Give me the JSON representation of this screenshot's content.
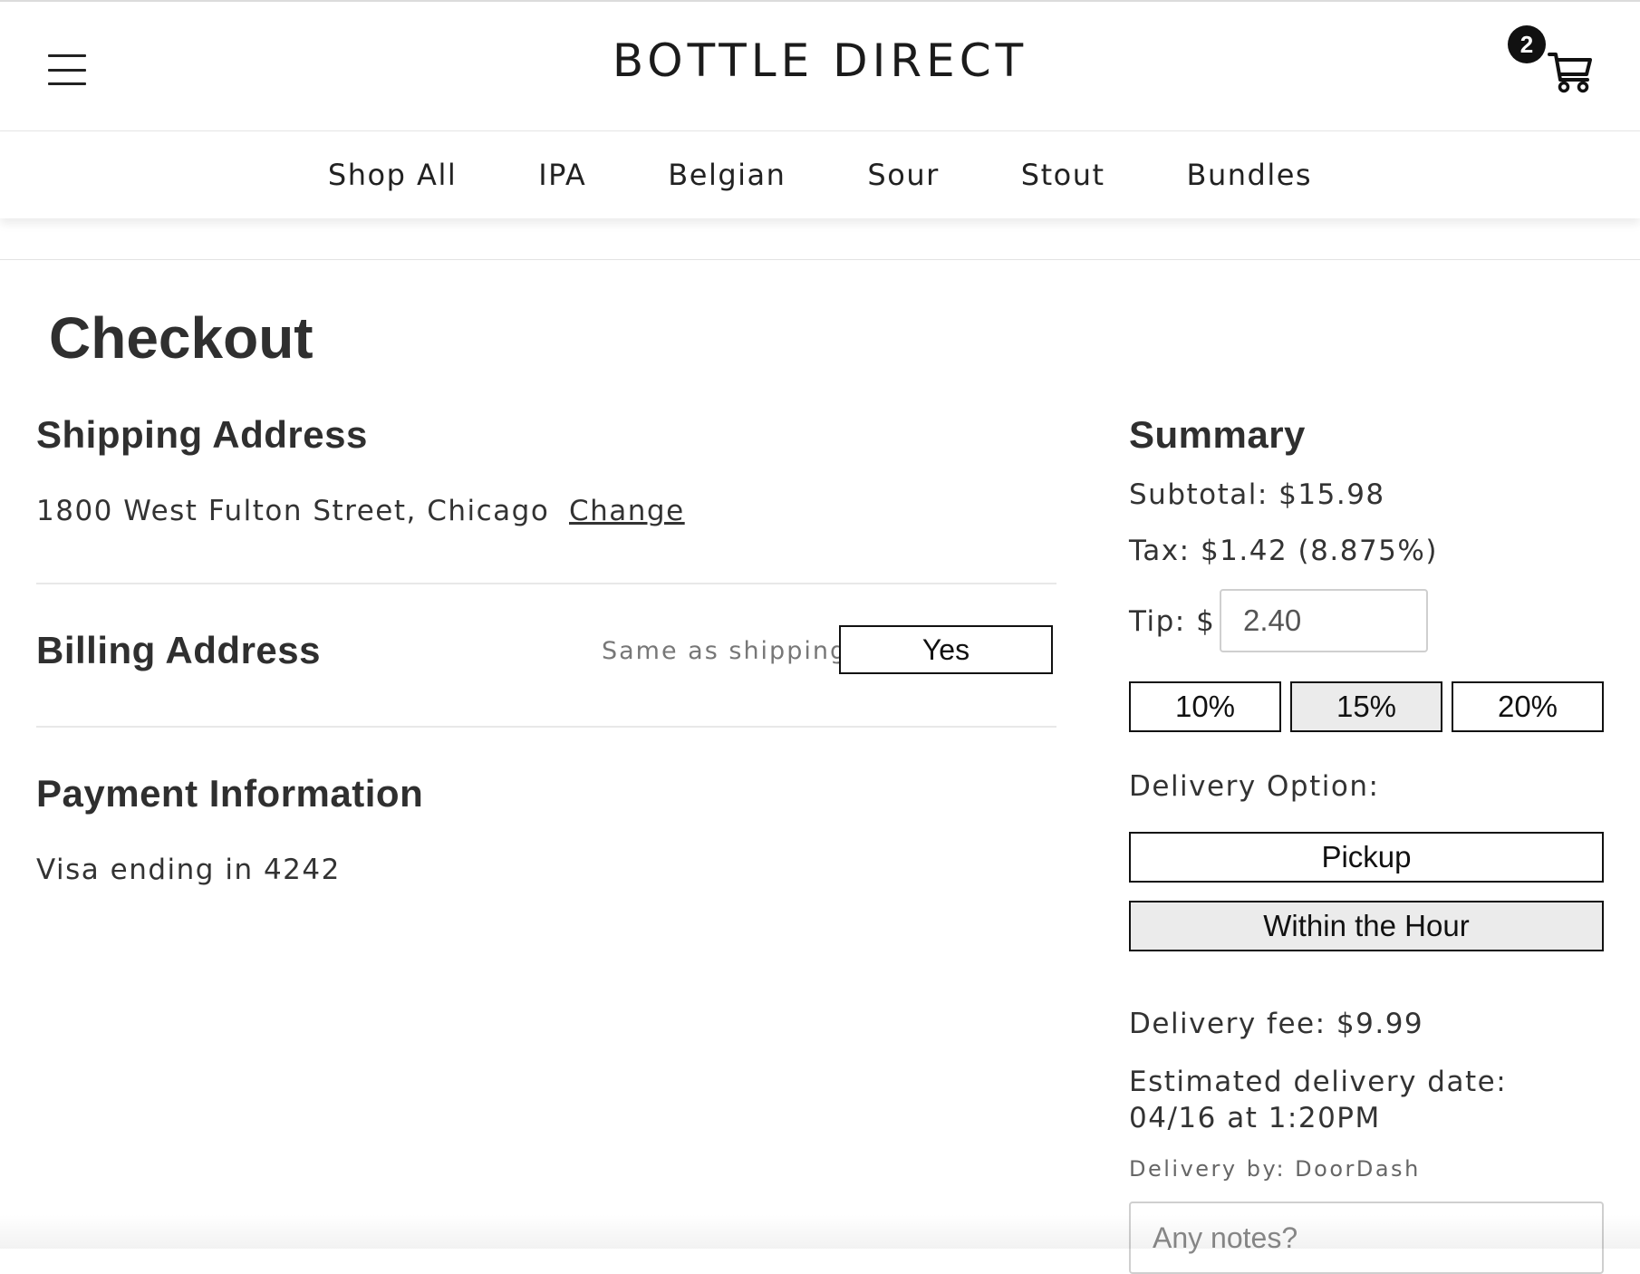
{
  "header": {
    "brand": "BOTTLE DIRECT",
    "cart_count": "2"
  },
  "nav": {
    "items": [
      "Shop All",
      "IPA",
      "Belgian",
      "Sour",
      "Stout",
      "Bundles"
    ]
  },
  "page": {
    "title": "Checkout"
  },
  "shipping": {
    "title": "Shipping Address",
    "address": "1800 West Fulton Street, Chicago",
    "change_label": "Change"
  },
  "billing": {
    "title": "Billing Address",
    "same_label": "Same as shipping:",
    "same_value": "Yes"
  },
  "payment": {
    "title": "Payment Information",
    "card": "Visa ending in 4242"
  },
  "summary": {
    "title": "Summary",
    "subtotal": "Subtotal: $15.98",
    "tax": "Tax: $1.42 (8.875%)",
    "tip_label": "Tip: $",
    "tip_value": "2.40",
    "tip_options": [
      "10%",
      "15%",
      "20%"
    ],
    "tip_selected": "15%",
    "delivery_option_label": "Delivery Option:",
    "delivery_options": [
      "Pickup",
      "Within the Hour"
    ],
    "delivery_selected": "Within the Hour",
    "delivery_fee": "Delivery fee: $9.99",
    "estimated_delivery": "Estimated delivery date: 04/16 at 1:20PM",
    "delivery_by": "Delivery by: DoorDash",
    "notes_placeholder": "Any notes?"
  },
  "colors": {
    "text": "#2b2b2b",
    "border": "#111111",
    "selected_bg": "#ebebeb",
    "muted": "#777777"
  }
}
